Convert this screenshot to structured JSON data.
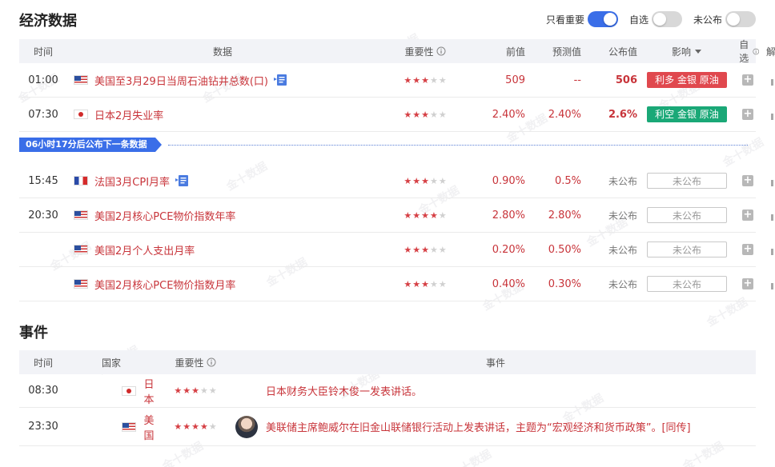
{
  "econ": {
    "title": "经济数据",
    "toggles": [
      {
        "label": "只看重要",
        "on": true
      },
      {
        "label": "自选",
        "on": false
      },
      {
        "label": "未公布",
        "on": false
      }
    ],
    "headers": {
      "time": "时间",
      "data": "数据",
      "importance": "重要性",
      "prev": "前值",
      "forecast": "预测值",
      "actual": "公布值",
      "effect": "影响",
      "fav": "自选",
      "analysis": "解读"
    },
    "rows": [
      {
        "time": "01:00",
        "country": "us",
        "name": "美国至3月29日当周石油钻井总数(口)",
        "doc": true,
        "stars": 3,
        "prev": "509",
        "forecast": "--",
        "actual": "506",
        "actual_style": "bold",
        "effect": "利多 金银 原油",
        "effect_color": "#e0484e"
      },
      {
        "time": "07:30",
        "country": "jp",
        "name": "日本2月失业率",
        "doc": false,
        "stars": 3,
        "prev": "2.40%",
        "forecast": "2.40%",
        "actual": "2.6%",
        "actual_style": "bold",
        "effect": "利空 金银 原油",
        "effect_color": "#1aa877"
      }
    ],
    "divider": "06小时17分后公布下一条数据",
    "rows_after": [
      {
        "time": "15:45",
        "country": "fr",
        "name": "法国3月CPI月率",
        "doc": true,
        "stars": 3,
        "prev": "0.90%",
        "forecast": "0.5%",
        "actual": "未公布",
        "effect": "未公布"
      },
      {
        "time": "20:30",
        "country": "us",
        "name": "美国2月核心PCE物价指数年率",
        "doc": false,
        "stars": 4,
        "prev": "2.80%",
        "forecast": "2.80%",
        "actual": "未公布",
        "effect": "未公布"
      },
      {
        "time": "",
        "country": "us",
        "name": "美国2月个人支出月率",
        "doc": false,
        "stars": 3,
        "prev": "0.20%",
        "forecast": "0.50%",
        "actual": "未公布",
        "effect": "未公布"
      },
      {
        "time": "",
        "country": "us",
        "name": "美国2月核心PCE物价指数月率",
        "doc": false,
        "stars": 3,
        "prev": "0.40%",
        "forecast": "0.30%",
        "actual": "未公布",
        "effect": "未公布"
      }
    ]
  },
  "events": {
    "title": "事件",
    "headers": {
      "time": "时间",
      "country": "国家",
      "importance": "重要性",
      "event": "事件"
    },
    "rows": [
      {
        "time": "08:30",
        "country": "jp",
        "country_name": "日本",
        "stars": 3,
        "avatar": false,
        "text": "日本财务大臣铃木俊一发表讲话。"
      },
      {
        "time": "23:30",
        "country": "us",
        "country_name": "美国",
        "stars": 4,
        "avatar": true,
        "text": "美联储主席鲍威尔在旧金山联储银行活动上发表讲话，主题为“宏观经济和货币政策”。[同传]"
      }
    ]
  },
  "watermark": "金十数据",
  "icons": {
    "info": "info-icon",
    "sort": "triangle-down-icon",
    "add": "plus-icon",
    "analysis": "bar-chart-icon",
    "doc": "document-icon"
  },
  "colors": {
    "accent": "#3a6ee8",
    "red": "#c8343a",
    "bull": "#e0484e",
    "bear": "#1aa877"
  }
}
